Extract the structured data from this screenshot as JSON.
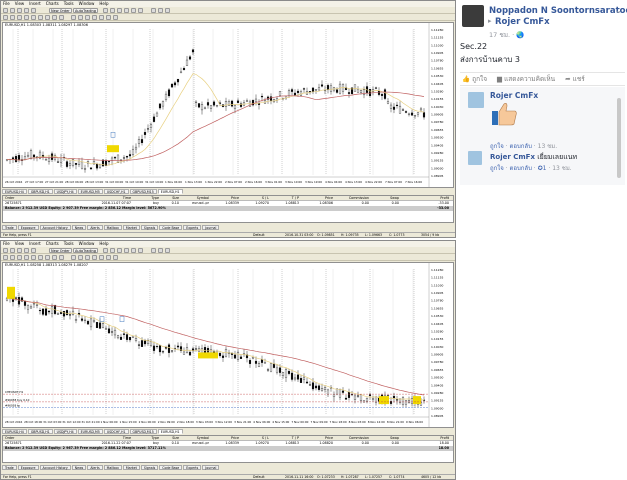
{
  "mt4_top": {
    "menu": [
      "File",
      "View",
      "Insert",
      "Charts",
      "Tools",
      "Window",
      "Help"
    ],
    "toolbar_new_order": "New Order",
    "toolbar_autotrading": "AutoTrading",
    "chart_title": "EURUSD,H1  1.08303 1.08311 1.08297 1.08306",
    "time_labels": [
      "26 Oct 2016",
      "27 Oct 17:00",
      "27 Oct 21:00",
      "28 Oct 06:00",
      "28 Oct 13:00",
      "31 Oct 00:00",
      "31 Oct 10:00",
      "31 Oct 19:00",
      "1 Nov 04:00",
      "1 Nov 13:00",
      "1 Nov 22:00",
      "2 Nov 07:00",
      "2 Nov 16:00",
      "3 Nov 01:00",
      "3 Nov 10:00",
      "3 Nov 19:00",
      "4 Nov 04:00",
      "4 Nov 13:00",
      "4 Nov 22:00",
      "7 Nov 07:00",
      "7 Nov 16:00"
    ],
    "price_labels": [
      "1.11280",
      "1.11155",
      "1.11030",
      "1.10905",
      "1.10780",
      "1.10655",
      "1.10530",
      "1.10405",
      "1.10280",
      "1.10155",
      "1.10030",
      "1.09905",
      "1.09780",
      "1.09655",
      "1.09530",
      "1.09405",
      "1.09280",
      "1.09155",
      "1.09030",
      "1.08905"
    ],
    "symbol_tabs": [
      "EURUSD,H4",
      "GBPUSD,H1",
      "USDJPY,H4",
      "EURUSD,M5",
      "USDCHF,H1",
      "GBPUSD,M15",
      "EURUSD,H1"
    ],
    "terminal": {
      "headers": [
        "Order",
        "Time",
        "Type",
        "Size",
        "Symbol",
        "Price",
        "S / L",
        "T / P",
        "Price",
        "Commission",
        "Swap",
        "Profit"
      ],
      "row": [
        "26725871",
        "2016.11.07 07:07",
        "buy",
        "0.10",
        "eurusd..pr",
        "1.08339",
        "1.09270",
        "1.08813",
        "1.08306",
        "0.00",
        "0.00",
        "-33.00"
      ],
      "balance": "Balance: 2 912.39 USD  Equity: 2 907.39  Free margin: 2 856.12  Margin level: 5672.90%",
      "balance_profit": "-33.00"
    },
    "term_tabs": [
      "Trade",
      "Exposure",
      "Account History",
      "News",
      "Alerts",
      "Mailbox",
      "Market",
      "Signals",
      "Code Base",
      "Experts",
      "Journal"
    ],
    "status": {
      "help": "For Help, press F1",
      "profile": "Default",
      "datetime": "2016.10.31 03:00",
      "o": "O: 1.09851",
      "h": "H: 1.09735",
      "l": "L: 1.09663",
      "c": "C: 1.0773",
      "traffic": "3054 / 9 kb"
    }
  },
  "mt4_bottom": {
    "menu": [
      "File",
      "View",
      "Insert",
      "Charts",
      "Tools",
      "Window",
      "Help"
    ],
    "toolbar_new_order": "New Order",
    "toolbar_autotrading": "AutoTrading",
    "chart_title": "EURUSD,H1  1.08258 1.08313 1.08279 1.08207",
    "time_labels": [
      "28 Oct 2016",
      "28 Oct 18:00",
      "31 Oct 03:00",
      "31 Oct 12:00",
      "31 Oct 21:00",
      "1 Nov 06:00",
      "1 Nov 15:00",
      "2 Nov 00:00",
      "2 Nov 09:00",
      "2 Nov 18:00",
      "3 Nov 03:00",
      "3 Nov 12:00",
      "3 Nov 21:00",
      "4 Nov 06:00",
      "4 Nov 15:00",
      "7 Nov 00:00",
      "7 Nov 09:00",
      "7 Nov 18:00",
      "8 Nov 03:00",
      "8 Nov 12:00",
      "8 Nov 21:00",
      "9 Nov 06:00"
    ],
    "price_labels": [
      "1.11280",
      "1.11155",
      "1.11030",
      "1.10905",
      "1.10780",
      "1.10655",
      "1.10530",
      "1.10405",
      "1.10280",
      "1.10155",
      "1.10030",
      "1.09905",
      "1.09780",
      "1.09655",
      "1.09530",
      "1.09405",
      "1.09280",
      "1.09155",
      "1.09030",
      "1.08905"
    ],
    "level_labels": [
      "CHEUSDT,H1",
      "#96038 buy 0.10",
      "#96038 tp"
    ],
    "symbol_tabs": [
      "EURUSD,H4",
      "GBPUSD,H1",
      "USDJPY,H4",
      "EURUSD,M5",
      "USDCHF,H1",
      "GBPUSD,M15",
      "EURUSD,H1"
    ],
    "terminal": {
      "headers": [
        "Order",
        "Time",
        "Type",
        "Size",
        "Symbol",
        "Price",
        "S / L",
        "T / P",
        "Price",
        "Commission",
        "Swap",
        "Profit"
      ],
      "row": [
        "26725871",
        "2016.11.22 07:07",
        "buy",
        "0.10",
        "eurusd..pr",
        "1.08339",
        "1.09270",
        "1.08813",
        "1.08820",
        "0.00",
        "0.00",
        "18.00"
      ],
      "balance": "Balance: 2 912.39 USD  Equity: 2 967.39  Free margin: 2 886.12  Margin level: 3717.11%",
      "balance_profit": "18.00"
    },
    "term_tabs": [
      "Trade",
      "Exposure",
      "Account History",
      "News",
      "Alerts",
      "Mailbox",
      "Market",
      "Signals",
      "Code Base",
      "Experts",
      "Journal"
    ],
    "status": {
      "help": "For Help, press F1",
      "profile": "Default",
      "datetime": "2016.11.11 16:00",
      "o": "O: 1.07233",
      "h": "H: 1.07287",
      "l": "L: 1.07257",
      "c": "C: 1.0774",
      "traffic": "4605 / 12 kb"
    }
  },
  "facebook": {
    "author": "Noppadon N Soontornsaratoon",
    "target": "Rojer CmFx",
    "time": "17 ชม. · 🌏",
    "text_line1": "Sec.22",
    "text_line2": "ส่งการบ้านคาบ 3",
    "actions": [
      "ถูกใจ",
      "แสดงความคิดเห็น",
      "แชร์"
    ],
    "comment1": {
      "name": "Rojer CmFx",
      "like": "ถูกใจ",
      "reply": "ตอบกลับ",
      "time": "13 ชม."
    },
    "comment2": {
      "name": "Rojer CmFx",
      "text": "เยี่ยมเลยแนท",
      "like": "ถูกใจ",
      "reply": "ตอบกลับ",
      "likes": "1",
      "time": "13 ชม."
    }
  },
  "colors": {
    "candle": "#000000",
    "ma_fast": "#e8d080",
    "ma_slow": "#c06060",
    "fb_blue": "#365899",
    "mt4_bg": "#ece9d8"
  },
  "chart_data": [
    {
      "type": "candlestick",
      "symbol": "EURUSD",
      "timeframe": "H1",
      "y_range": [
        1.089,
        1.1135
      ],
      "trend": "rising"
    },
    {
      "type": "candlestick",
      "symbol": "EURUSD",
      "timeframe": "H1",
      "y_range": [
        1.089,
        1.1135
      ],
      "trend": "falling"
    }
  ]
}
